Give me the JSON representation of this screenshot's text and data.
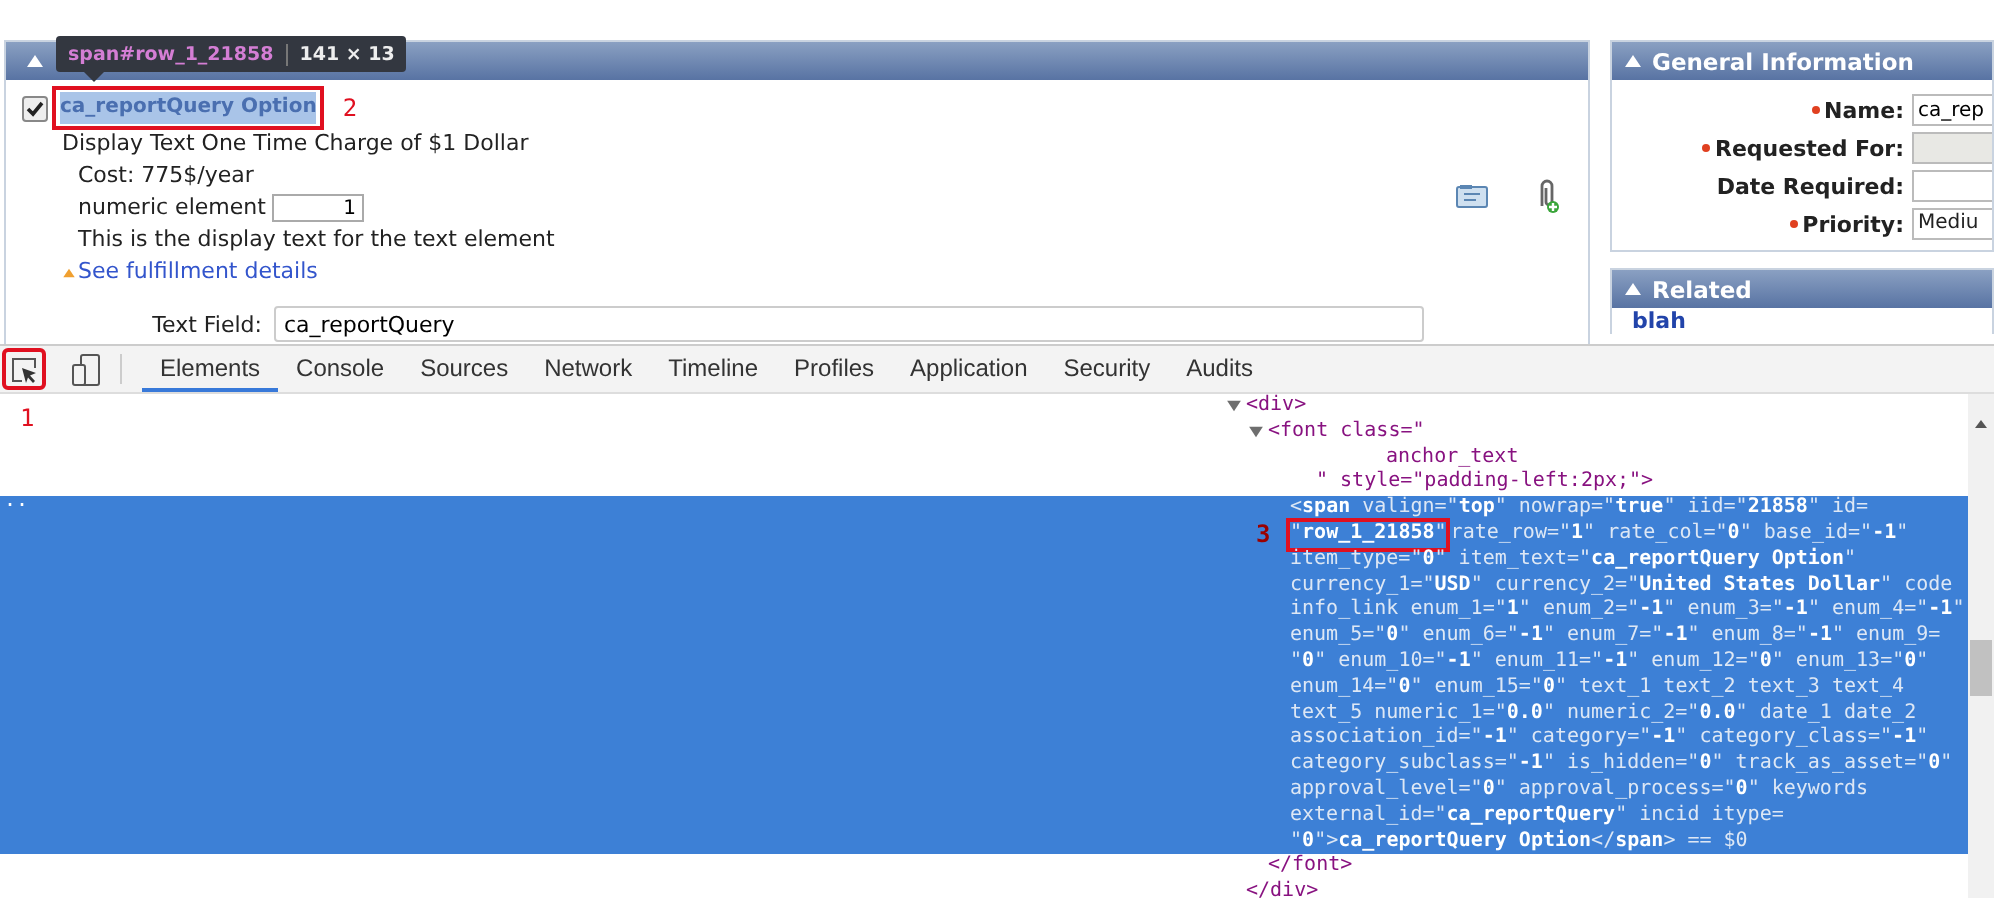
{
  "tooltip": {
    "selector": "span#row_1_21858",
    "size": "141 × 13"
  },
  "main_panel": {
    "expanded": true,
    "item": {
      "checked": true,
      "name": "ca_reportQuery Option",
      "highlighted": true,
      "callout": "2"
    },
    "description": "Display Text One Time Charge of $1 Dollar",
    "cost": "Cost: 775$/year",
    "numeric": {
      "label": "numeric element",
      "value": "1"
    },
    "display_text": "This is the display text for the text element",
    "details_link": "See fulfillment details",
    "text_field": {
      "label": "Text Field:",
      "value": "ca_reportQuery"
    }
  },
  "general_information": {
    "title": "General Information",
    "expanded": true,
    "fields": [
      {
        "label": "Name:",
        "required": true,
        "kind": "text",
        "value": "ca_rep"
      },
      {
        "label": "Requested For:",
        "required": true,
        "kind": "readonly"
      },
      {
        "label": "Date Required:",
        "required": false,
        "kind": "text"
      },
      {
        "label": "Priority:",
        "required": true,
        "kind": "select",
        "value": "Mediu"
      }
    ]
  },
  "related": {
    "title": "Related",
    "expanded": true,
    "links": [
      "blah"
    ]
  },
  "devtools": {
    "inspect_callout": "1",
    "tabs": [
      {
        "label": "Elements",
        "selected": true
      },
      {
        "label": "Console",
        "selected": false
      },
      {
        "label": "Sources",
        "selected": false
      },
      {
        "label": "Network",
        "selected": false
      },
      {
        "label": "Timeline",
        "selected": false
      },
      {
        "label": "Profiles",
        "selected": false
      },
      {
        "label": "Application",
        "selected": false
      },
      {
        "label": "Security",
        "selected": false
      },
      {
        "label": "Audits",
        "selected": false
      }
    ],
    "tree": [
      {
        "expanded": true,
        "selected": false,
        "lines": [
          {
            "text": "<div>"
          }
        ],
        "closing": "</div>",
        "children": [
          {
            "expanded": true,
            "selected": false,
            "lines": [
              {
                "text": "<font class=\""
              },
              {
                "text": "anchor_text"
              },
              {
                "text": "\" style=\"padding-left:2px;\">"
              }
            ],
            "closing": "</font>",
            "children": [
              {
                "selected": true,
                "marker": "..",
                "lines": [
                  {
                    "text": "<**span** valign=\"**top**\" nowrap=\"**true**\" iid=\"**21858**\" id="
                  },
                  {
                    "boxed": "\"**row_1_21858**\"",
                    "callout": "3",
                    "text": " rate_row=\"**1**\" rate_col=\"**0**\" base_id=\"**-1**\""
                  },
                  {
                    "text": "item_type=\"**0**\" item_text=\"**ca_reportQuery Option**\""
                  },
                  {
                    "text": "currency_1=\"**USD**\" currency_2=\"**United States Dollar**\" code"
                  },
                  {
                    "text": "info_link enum_1=\"**1**\" enum_2=\"**-1**\" enum_3=\"**-1**\" enum_4=\"**-1**\""
                  },
                  {
                    "text": "enum_5=\"**0**\" enum_6=\"**-1**\" enum_7=\"**-1**\" enum_8=\"**-1**\" enum_9="
                  },
                  {
                    "text": "\"**0**\" enum_10=\"**-1**\" enum_11=\"**-1**\" enum_12=\"**0**\" enum_13=\"**0**\""
                  },
                  {
                    "text": "enum_14=\"**0**\" enum_15=\"**0**\" text_1 text_2 text_3 text_4"
                  },
                  {
                    "text": "text_5 numeric_1=\"**0.0**\" numeric_2=\"**0.0**\" date_1 date_2"
                  },
                  {
                    "text": "association_id=\"**-1**\" category=\"**-1**\" category_class=\"**-1**\""
                  },
                  {
                    "text": "category_subclass=\"**-1**\" is_hidden=\"**0**\" track_as_asset=\"**0**\""
                  },
                  {
                    "text": "approval_level=\"**0**\" approval_process=\"**0**\" keywords"
                  },
                  {
                    "text": "external_id=\"**ca_reportQuery**\" incid itype="
                  },
                  {
                    "text": "\"**0**\">**ca_reportQuery Option**</**span**> == $0"
                  }
                ]
              }
            ]
          }
        ]
      }
    ]
  }
}
